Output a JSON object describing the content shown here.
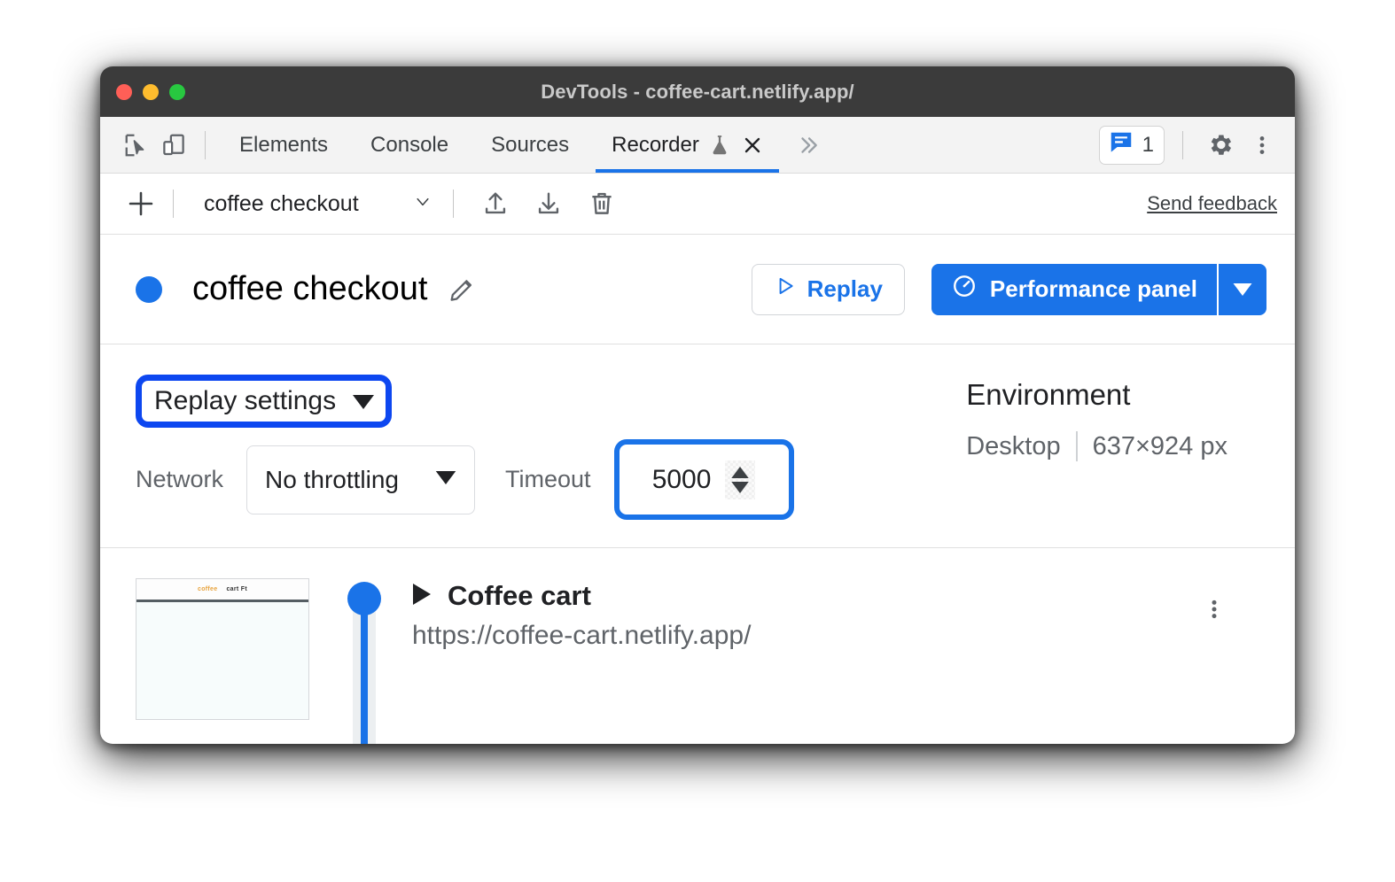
{
  "window": {
    "title": "DevTools - coffee-cart.netlify.app/"
  },
  "tabbar": {
    "inspect_icon": "inspect-cursor-icon",
    "device_icon": "device-toolbar-icon",
    "tabs": [
      {
        "label": "Elements",
        "active": false
      },
      {
        "label": "Console",
        "active": false
      },
      {
        "label": "Sources",
        "active": false
      },
      {
        "label": "Recorder",
        "active": true
      }
    ],
    "recorder_experiment_icon": "flask-icon",
    "recorder_close_icon": "close-icon",
    "more_tabs_icon": "chevron-double-right-icon",
    "issues_count": "1",
    "issues_icon": "issues-message-icon",
    "settings_icon": "gear-icon",
    "more_options_icon": "three-dot-vertical-icon"
  },
  "recorder_toolbar": {
    "add_icon": "plus-icon",
    "recording_name": "coffee checkout",
    "recording_select_caret": "chevron-down-icon",
    "import_icon": "upload-icon",
    "export_icon": "download-icon",
    "delete_icon": "trash-icon",
    "send_feedback": "Send feedback"
  },
  "header": {
    "status_dot_color": "#1a73e8",
    "title": "coffee checkout",
    "edit_icon": "pencil-icon",
    "replay_label": "Replay",
    "replay_icon": "play-triangle-icon",
    "performance_label": "Performance panel",
    "performance_icon": "gauge-icon",
    "performance_caret_icon": "caret-down-icon"
  },
  "settings": {
    "replay_settings_label": "Replay settings",
    "replay_settings_caret": "caret-down-icon",
    "network_label": "Network",
    "network_value": "No throttling",
    "network_caret_icon": "caret-down-icon",
    "timeout_label": "Timeout",
    "timeout_value": "5000",
    "timeout_spinner_icon": "spinner-up-down-icon",
    "highlight_color_settings": "#0d47f0",
    "highlight_color_timeout": "#1a73e8"
  },
  "environment": {
    "title": "Environment",
    "device": "Desktop",
    "viewport": "637×924 px"
  },
  "steps": [
    {
      "thumbnail_logo": "coffee",
      "thumbnail_title": "cart Ft",
      "expand_icon": "triangle-right-icon",
      "name": "Coffee cart",
      "url": "https://coffee-cart.netlify.app/",
      "menu_icon": "three-dot-vertical-icon"
    }
  ]
}
